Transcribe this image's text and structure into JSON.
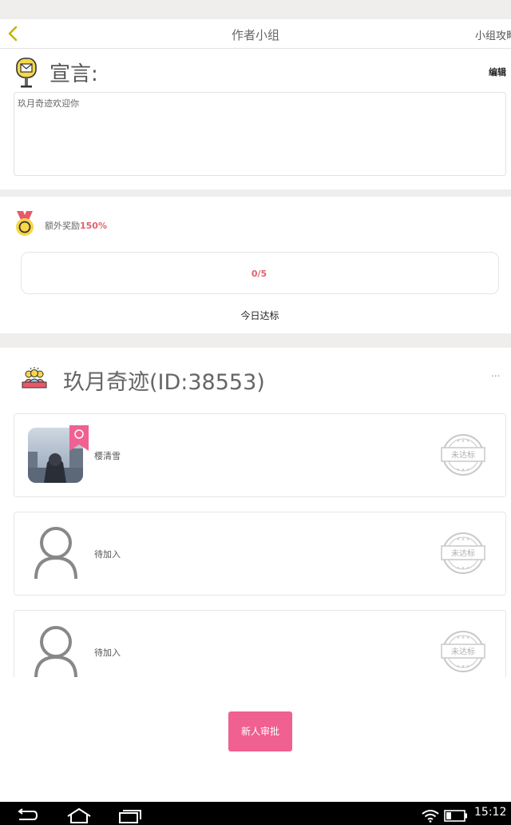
{
  "nav": {
    "title": "作者小组",
    "right_label": "小组攻略"
  },
  "declaration": {
    "title": "宣言:",
    "edit_label": "编辑",
    "text": "玖月奇迹欢迎你"
  },
  "bonus": {
    "label": "额外奖励",
    "value": "150%"
  },
  "progress": {
    "text": "0/5",
    "caption": "今日达标"
  },
  "group": {
    "title": "玖月奇迹(ID:38553)",
    "more": "..."
  },
  "members": [
    {
      "name": "樱清雪",
      "stamp": "未达标"
    },
    {
      "name": "待加入",
      "stamp": "未达标"
    },
    {
      "name": "待加入",
      "stamp": "未达标"
    }
  ],
  "actions": {
    "approve_label": "新人审批"
  },
  "statusbar": {
    "time": "15:12"
  },
  "colors": {
    "accent_pink": "#f06090",
    "highlight_red": "#e26070"
  }
}
